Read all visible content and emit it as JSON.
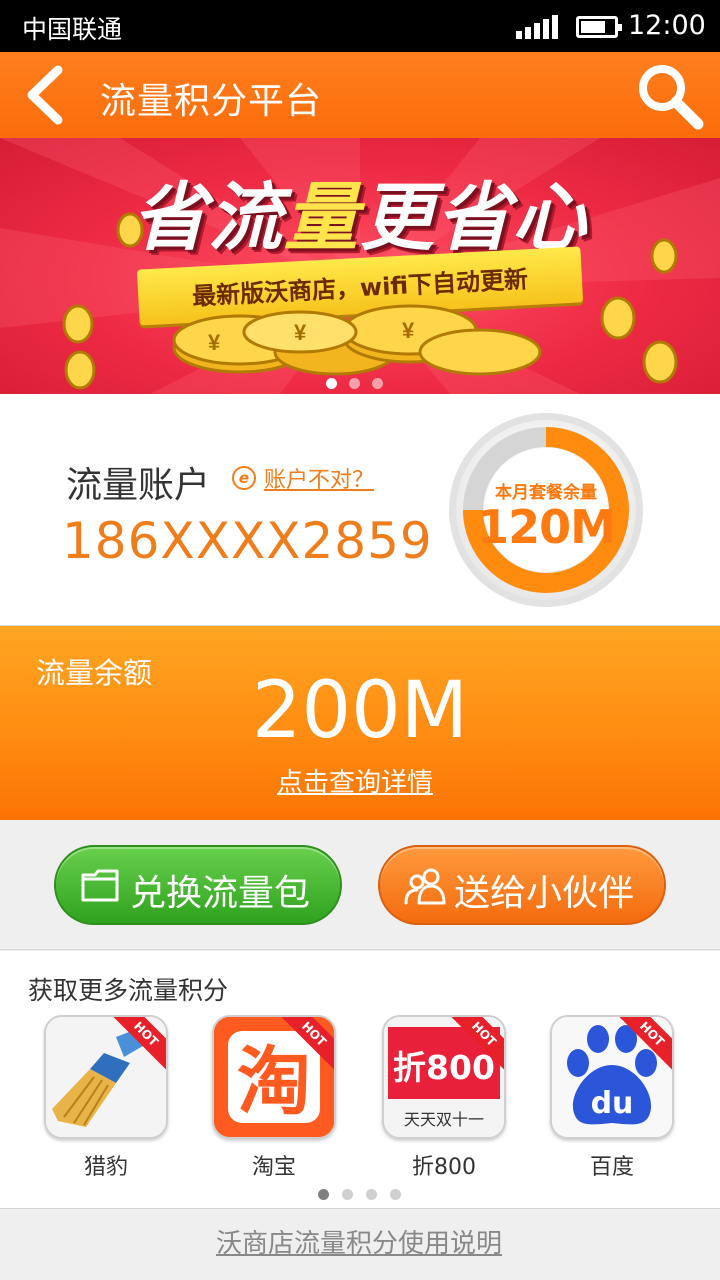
{
  "status_bar": {
    "carrier": "中国联通",
    "time": "12:00",
    "battery_level": 0.75
  },
  "header": {
    "title": "流量积分平台",
    "back_icon": "chevron-left-icon",
    "search_icon": "search-icon"
  },
  "banner": {
    "headline_parts": [
      "省流",
      "量",
      "更省心"
    ],
    "subtitle": "最新版沃商店，wifi下自动更新",
    "slide_count": 3,
    "active_slide": 1
  },
  "account": {
    "label": "流量账户",
    "wrong_account_link": "账户不对？",
    "phone": "186XXXX2859",
    "monthly_remaining_label": "本月套餐余量",
    "monthly_remaining_value": "120M",
    "monthly_remaining_fraction": 0.75
  },
  "balance": {
    "label": "流量余额",
    "value": "200M",
    "detail_link": "点击查询详情"
  },
  "actions": {
    "exchange": {
      "label": "兑换流量包",
      "icon": "folder-icon"
    },
    "gift": {
      "label": "送给小伙伴",
      "icon": "people-icon"
    }
  },
  "more": {
    "title": "获取更多流量积分",
    "hot_badge": "HOT",
    "apps": [
      {
        "name": "猎豹",
        "icon": "broom-icon"
      },
      {
        "name": "淘宝",
        "icon": "taobao-icon",
        "glyph": "淘"
      },
      {
        "name": "折800",
        "icon": "zhe800-icon",
        "glyph": "折800",
        "sub": "天天双十一"
      },
      {
        "name": "百度",
        "icon": "baidu-paw-icon",
        "glyph": "du"
      }
    ],
    "page_count": 4,
    "active_page": 1
  },
  "footer": {
    "link": "沃商店流量积分使用说明"
  },
  "colors": {
    "orange": "#fb6c0a",
    "green": "#2fa21f",
    "banner_red": "#ee2a44"
  }
}
